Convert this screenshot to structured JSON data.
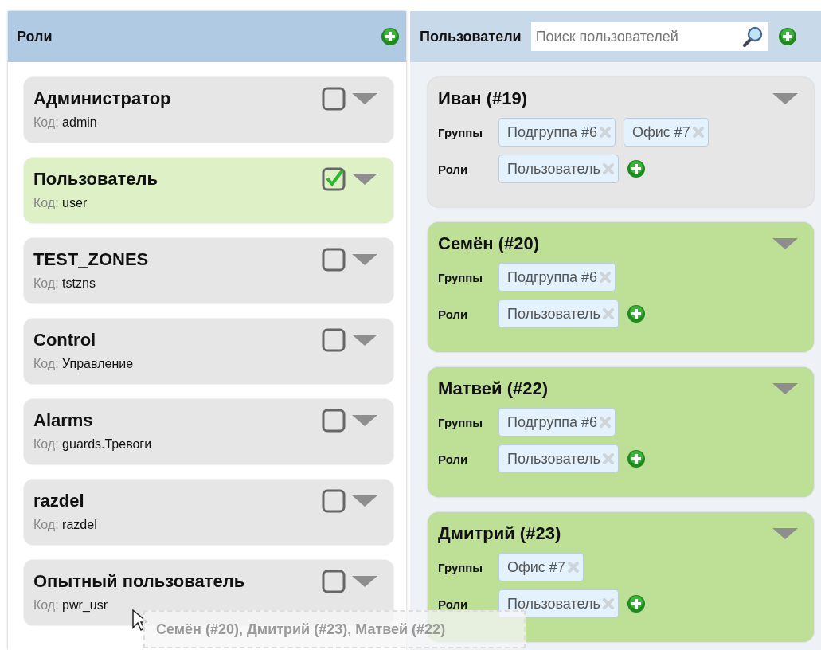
{
  "roles_panel": {
    "title": "Роли"
  },
  "roles": [
    {
      "name": "Администратор",
      "code_label": "Код:",
      "code": "admin",
      "checked": false
    },
    {
      "name": "Пользователь",
      "code_label": "Код:",
      "code": "user",
      "checked": true
    },
    {
      "name": "TEST_ZONES",
      "code_label": "Код:",
      "code": "tstzns",
      "checked": false
    },
    {
      "name": "Control",
      "code_label": "Код:",
      "code": "Управление",
      "checked": false
    },
    {
      "name": "Alarms",
      "code_label": "Код:",
      "code": "guards.Тревоги",
      "checked": false
    },
    {
      "name": "razdel",
      "code_label": "Код:",
      "code": "razdel",
      "checked": false
    },
    {
      "name": "Опытный пользователь",
      "code_label": "Код:",
      "code": "pwr_usr",
      "checked": false
    }
  ],
  "users_panel": {
    "title": "Пользователи",
    "search": {
      "placeholder": "Поиск пользователей"
    }
  },
  "users": [
    {
      "name": "Иван (#19)",
      "selected": false,
      "groups_label": "Группы",
      "groups": [
        "Подгруппа #6",
        "Офис #7"
      ],
      "roles_label": "Роли",
      "roles": [
        "Пользователь"
      ]
    },
    {
      "name": "Семён (#20)",
      "selected": true,
      "groups_label": "Группы",
      "groups": [
        "Подгруппа #6"
      ],
      "roles_label": "Роли",
      "roles": [
        "Пользователь"
      ]
    },
    {
      "name": "Матвей (#22)",
      "selected": true,
      "groups_label": "Группы",
      "groups": [
        "Подгруппа #6"
      ],
      "roles_label": "Роли",
      "roles": [
        "Пользователь"
      ]
    },
    {
      "name": "Дмитрий (#23)",
      "selected": true,
      "groups_label": "Группы",
      "groups": [
        "Офис #7"
      ],
      "roles_label": "Роли",
      "roles": [
        "Пользователь"
      ]
    }
  ],
  "drag_ghost": {
    "text": "Семён (#20), Дмитрий (#23), Матвей (#22)"
  }
}
